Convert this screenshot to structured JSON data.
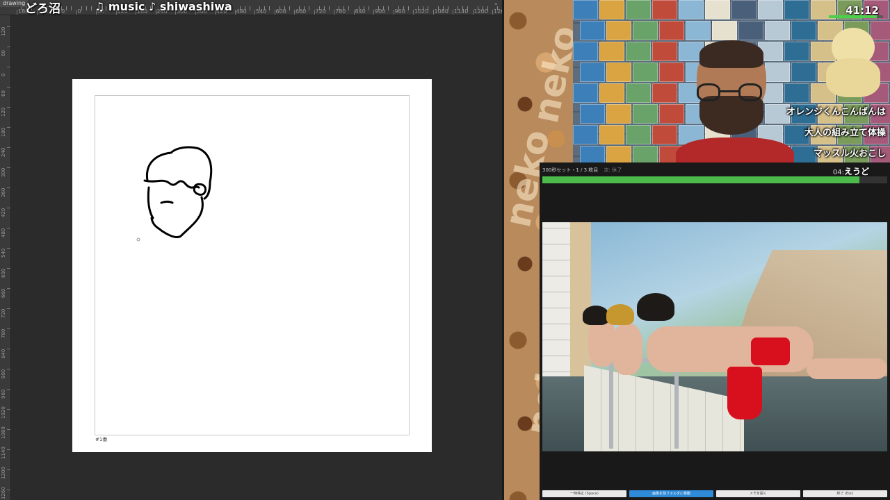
{
  "app": {
    "tab_label": "drawing",
    "overlay_title": "どろ沼",
    "music_label": "♫ music ♪ shiwashiwa",
    "collapse_icon": "chevron-down-icon"
  },
  "ruler": {
    "top_labels": [
      "180",
      "120",
      "60",
      "0",
      "60",
      "120",
      "180",
      "240",
      "300",
      "360",
      "420",
      "480",
      "540",
      "600",
      "660",
      "720",
      "780",
      "840",
      "900",
      "960",
      "1020",
      "1080",
      "1140",
      "1200",
      "1260",
      "1320"
    ],
    "left_labels": [
      "120",
      "60",
      "0",
      "60",
      "120",
      "180",
      "240",
      "300",
      "360",
      "420",
      "480",
      "540",
      "600",
      "660",
      "720",
      "780",
      "840",
      "900",
      "960",
      "1020",
      "1080",
      "1140",
      "1200",
      "1260"
    ]
  },
  "canvas": {
    "frame_caption": "#1番"
  },
  "stream": {
    "timer": "41:12",
    "timer_progress": 0.88,
    "tags": [
      "オレンジくんこんばんは",
      "大人の組み立て体操",
      "マッスル火おこし"
    ],
    "pattern_words": [
      "neko",
      "neko",
      "neko"
    ]
  },
  "viewer": {
    "header": "300秒セット・1 / 3 枚目",
    "subheader": "次: 休了",
    "time": "04:",
    "time_overlay": "えうど",
    "progress": 0.92,
    "buttons": [
      "一時停止 (Space)",
      "画像を別フォルダに移動",
      "メモを開く",
      "終了 (Esc)"
    ]
  }
}
